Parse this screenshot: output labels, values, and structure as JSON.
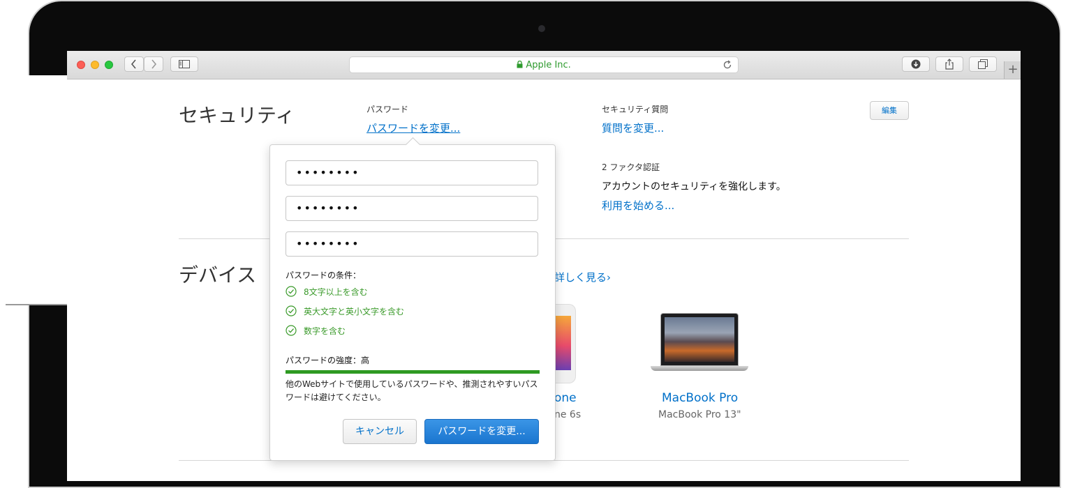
{
  "browser": {
    "address": "Apple Inc.",
    "new_tab": "+"
  },
  "security": {
    "title": "セキュリティ",
    "edit_label": "編集",
    "password_label": "パスワード",
    "password_link": "パスワードを変更...",
    "question_label": "セキュリティ質問",
    "question_link": "質問を変更...",
    "twofa_label": "2 ファクタ認証",
    "twofa_text": "アカウントのセキュリティを強化します。",
    "twofa_link": "利用を始める..."
  },
  "devices": {
    "title": "デバイス",
    "more_link": "詳しく見る",
    "items": [
      {
        "name": "one",
        "model": "ne 6s"
      },
      {
        "name": "MacBook Pro",
        "model": "MacBook Pro 13\""
      }
    ]
  },
  "popover": {
    "fields": [
      "••••••••",
      "••••••••",
      "••••••••"
    ],
    "requirements_title": "パスワードの条件：",
    "requirements": [
      "8文字以上を含む",
      "英大文字と英小文字を含む",
      "数字を含む"
    ],
    "strength_label": "パスワードの強度：高",
    "strength_level": 1.0,
    "note": "他のWebサイトで使用しているパスワードや、推測されやすいパスワードは避けてください。",
    "cancel": "キャンセル",
    "submit": "パスワードを変更..."
  },
  "colors": {
    "link": "#0070c9",
    "success": "#2e9a22",
    "primary_button": "#1f7fd8"
  }
}
